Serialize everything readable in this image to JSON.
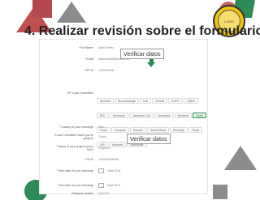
{
  "slide": {
    "title": "4. Realizar revisión sobre el formulario",
    "logo_text": "LOGO",
    "callout_1": "Verificar datos",
    "callout_2": "Verificar datos"
  },
  "form": {
    "fields": [
      {
        "label": "* Full Name",
        "value": "David Perez"
      },
      {
        "label": "* Email",
        "value": "david.email@domain.net"
      },
      {
        "label": "* EP ID",
        "value": "1000000000"
      },
      {
        "label": "EP Local Committee",
        "value": ""
      },
      {
        "label": "* Country of your exchange",
        "value": "Peru"
      },
      {
        "label": "* Local Committee where you're going to",
        "value": "Cusco"
      },
      {
        "label": "* Name of your project and/or NGO",
        "value": "Proyecto"
      },
      {
        "label": "* TN ID",
        "value": "1000000000000"
      },
      {
        "label": "* Start date of your exchange",
        "value": "June 2014"
      },
      {
        "label": "* End date of your exchange",
        "value": "Sept 2014"
      },
      {
        "label": "Passport number",
        "value": "Q1A123"
      }
    ],
    "committees": [
      "Armenia",
      "Bucaramanga",
      "Cali",
      "Central",
      "EAFIT",
      "UDEA",
      "ESL",
      "Javeriana",
      "Javeriana Cali",
      "Manizales",
      "Monteria",
      "Norte",
      "Pasto",
      "Popayan",
      "Rosario",
      "Santa Marta",
      "Sincelejo",
      "Tunja",
      "UIS",
      "Uninorte",
      "Valledupar"
    ],
    "selected_committee": "Norte"
  },
  "colors": {
    "accent_green": "#2e8b57",
    "accent_red": "#c0504d",
    "gray": "#8c8c8c",
    "logo_yellow": "#f1c40f"
  }
}
